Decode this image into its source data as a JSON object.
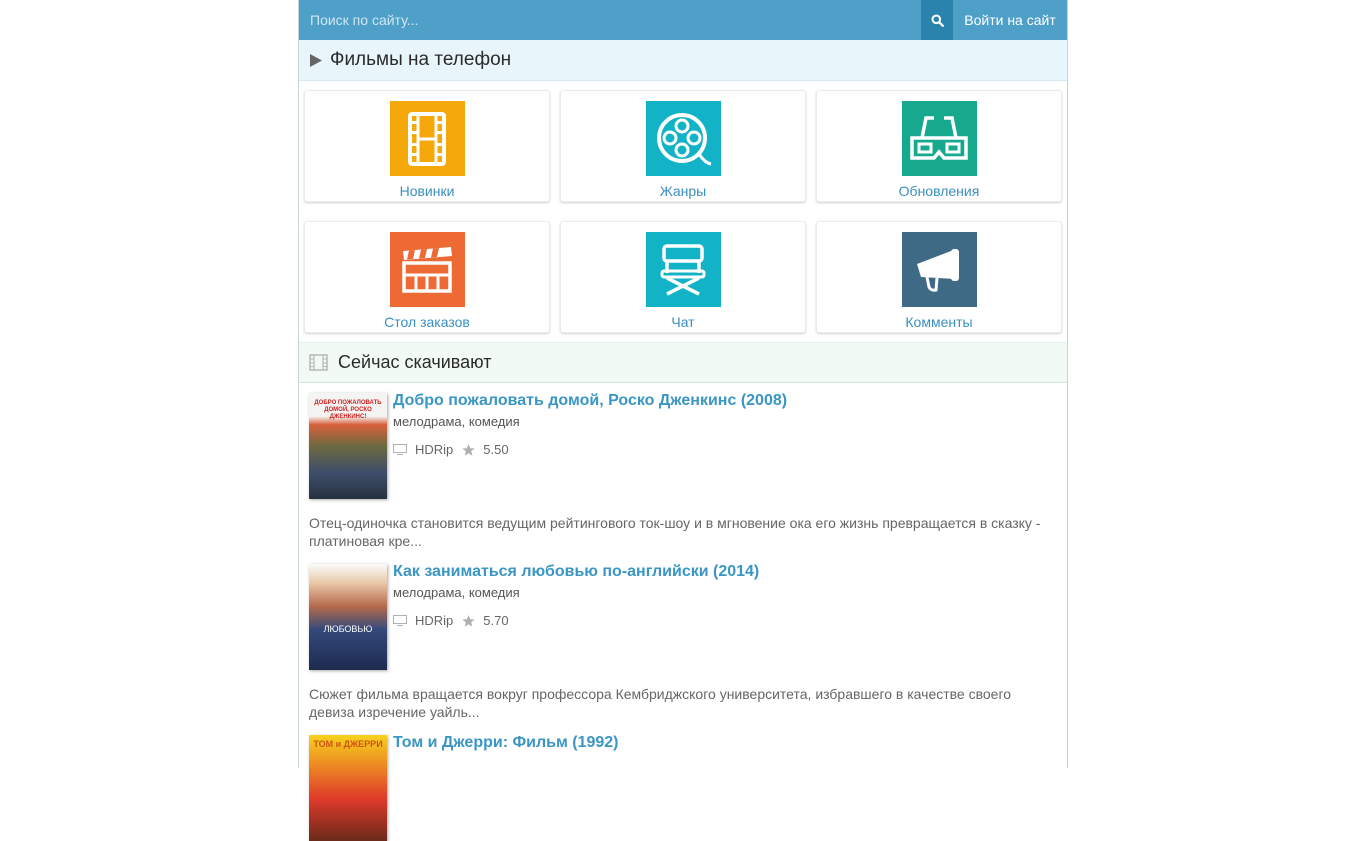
{
  "header": {
    "search_placeholder": "Поиск по сайту...",
    "login_label": "Войти на сайт"
  },
  "section1": {
    "title": "Фильмы на телефон"
  },
  "tiles": [
    {
      "label": "Новинки",
      "color": "#f5a80a",
      "icon": "film-strip-icon"
    },
    {
      "label": "Жанры",
      "color": "#13b3c7",
      "icon": "film-reel-icon"
    },
    {
      "label": "Обновления",
      "color": "#17a98e",
      "icon": "3d-glasses-icon"
    },
    {
      "label": "Стол заказов",
      "color": "#ee6a34",
      "icon": "clapperboard-icon"
    },
    {
      "label": "Чат",
      "color": "#13b3c7",
      "icon": "director-chair-icon"
    },
    {
      "label": "Комменты",
      "color": "#3f6a85",
      "icon": "megaphone-icon"
    }
  ],
  "section2": {
    "title": "Сейчас скачивают"
  },
  "movies": [
    {
      "title": "Добро пожаловать домой, Роско Дженкинс (2008)",
      "genre": "мелодрама, комедия",
      "quality": "HDRip",
      "rating": "5.50",
      "description": "Отец-одиночка становится ведущим рейтингового ток-шоу и в мгновение ока его жизнь превращается в сказку - платиновая кре...",
      "poster_text": "ДОБРО ПОЖАЛОВАТЬ ДОМОЙ, РОСКО ДЖЕНКИНС!"
    },
    {
      "title": "Как заниматься любовью по-английски (2014)",
      "genre": "мелодрама, комедия",
      "quality": "HDRip",
      "rating": "5.70",
      "description": "Сюжет фильма вращается вокруг профессора Кембриджского университета, избравшего в качестве своего девиза изречение уайль...",
      "poster_text": "ЛЮБОВЬЮ"
    },
    {
      "title": "Том и Джерри: Фильм (1992)",
      "poster_text": "ТОМ и ДЖЕРРИ"
    }
  ]
}
